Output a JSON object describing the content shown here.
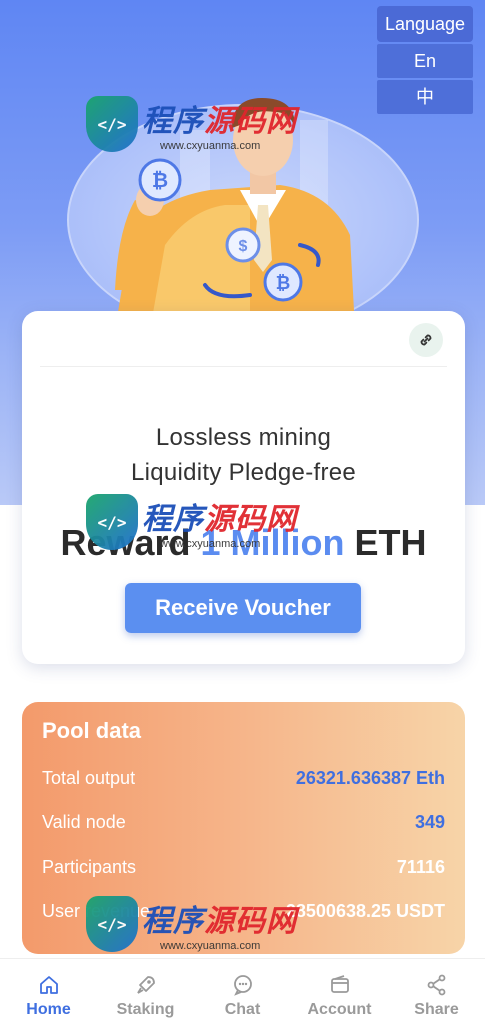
{
  "language_menu": {
    "title": "Language",
    "options": [
      "En",
      "中"
    ]
  },
  "hero_card": {
    "line1": "Lossless mining",
    "line2": "Liquidity Pledge-free",
    "reward_prefix": "Reward",
    "reward_amount": "1 Million",
    "reward_unit": "ETH",
    "button_label": "Receive Voucher",
    "link_icon": "link-icon"
  },
  "pool": {
    "title": "Pool data",
    "rows": [
      {
        "label": "Total output",
        "value": "26321.636387 Eth",
        "color": "#3f6fe0"
      },
      {
        "label": "Valid node",
        "value": "349",
        "color": "#3f6fe0"
      },
      {
        "label": "Participants",
        "value": "71116",
        "color": "#ffffff"
      },
      {
        "label": "User revenue",
        "value": "28500638.25 USDT",
        "color": "#ffffff"
      }
    ]
  },
  "tabs": [
    {
      "label": "Home",
      "icon": "home-icon",
      "active": true
    },
    {
      "label": "Staking",
      "icon": "rocket-icon",
      "active": false
    },
    {
      "label": "Chat",
      "icon": "chat-icon",
      "active": false
    },
    {
      "label": "Account",
      "icon": "wallet-icon",
      "active": false
    },
    {
      "label": "Share",
      "icon": "share-icon",
      "active": false
    }
  ],
  "watermark": {
    "cn_a": "程序",
    "cn_b": "源码网",
    "url": "www.cxyuanma.com"
  },
  "colors": {
    "accent": "#5b8ff0",
    "hero_blue": "#5f86f3",
    "pool_start": "#f39a6b",
    "pool_end": "#f7d4a8"
  }
}
